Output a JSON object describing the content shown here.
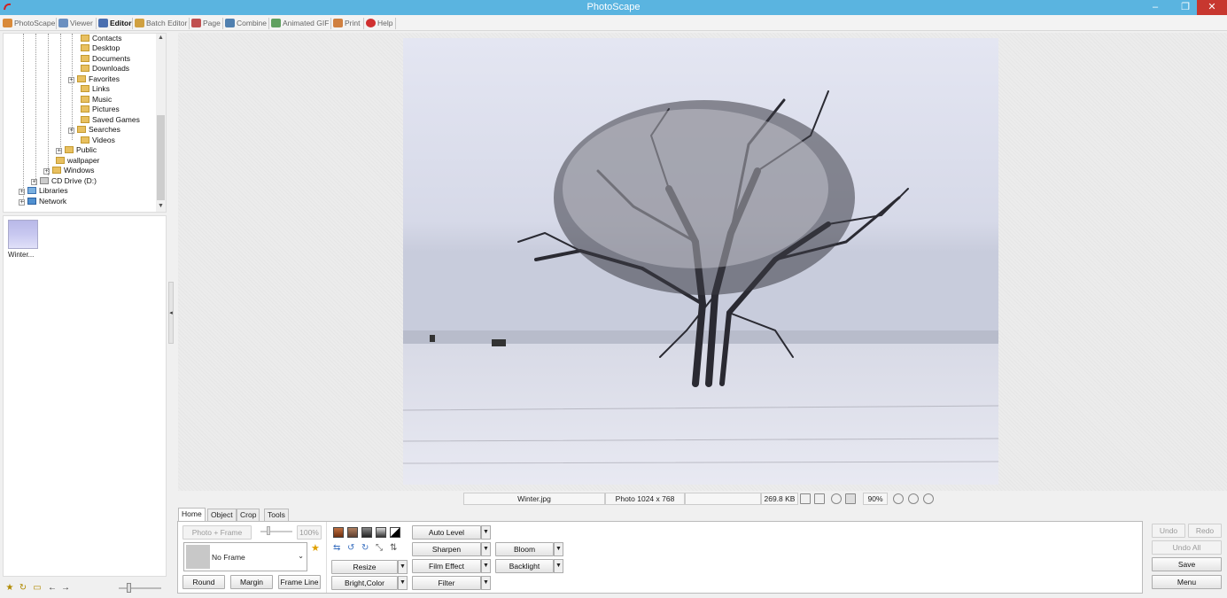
{
  "window": {
    "title": "PhotoScape"
  },
  "tabs": [
    {
      "label": "PhotoScape",
      "active": false
    },
    {
      "label": "Viewer",
      "active": false
    },
    {
      "label": "Editor",
      "active": true
    },
    {
      "label": "Batch Editor",
      "active": false
    },
    {
      "label": "Page",
      "active": false
    },
    {
      "label": "Combine",
      "active": false
    },
    {
      "label": "Animated GIF",
      "active": false
    },
    {
      "label": "Print",
      "active": false
    },
    {
      "label": "Help",
      "active": false
    }
  ],
  "tree": {
    "items": [
      {
        "label": "Contacts"
      },
      {
        "label": "Desktop"
      },
      {
        "label": "Documents"
      },
      {
        "label": "Downloads"
      },
      {
        "label": "Favorites",
        "expandable": "+"
      },
      {
        "label": "Links"
      },
      {
        "label": "Music"
      },
      {
        "label": "Pictures"
      },
      {
        "label": "Saved Games"
      },
      {
        "label": "Searches",
        "expandable": "+"
      },
      {
        "label": "Videos"
      },
      {
        "label": "Public",
        "expandable": "+"
      },
      {
        "label": "wallpaper"
      },
      {
        "label": "Windows",
        "expandable": "+"
      },
      {
        "label": "CD Drive (D:)",
        "expandable": "+"
      },
      {
        "label": "Libraries",
        "expandable": "+"
      },
      {
        "label": "Network",
        "expandable": "+"
      }
    ]
  },
  "thumbnails": [
    {
      "label": "Winter..."
    }
  ],
  "status": {
    "filename": "Winter.jpg",
    "dimensions": "Photo 1024 x 768",
    "filesize": "269.8 KB",
    "zoom": "90%"
  },
  "subtabs": [
    {
      "label": "Home",
      "active": true
    },
    {
      "label": "Object",
      "active": false
    },
    {
      "label": "Crop",
      "active": false
    },
    {
      "label": "Tools",
      "active": false
    }
  ],
  "home": {
    "photo_frame": "Photo + Frame",
    "frame_percent": "100%",
    "frame_select": "No Frame",
    "round": "Round",
    "margin": "Margin",
    "frame_line": "Frame Line",
    "resize": "Resize",
    "bright_color": "Bright,Color",
    "auto_level": "Auto Level",
    "sharpen": "Sharpen",
    "film_effect": "Film Effect",
    "filter": "Filter",
    "bloom": "Bloom",
    "backlight": "Backlight"
  },
  "actions": {
    "undo": "Undo",
    "redo": "Redo",
    "undo_all": "Undo All",
    "save": "Save",
    "menu": "Menu"
  },
  "colors": {
    "titlebar": "#5ab4e0",
    "close": "#c7372f"
  }
}
